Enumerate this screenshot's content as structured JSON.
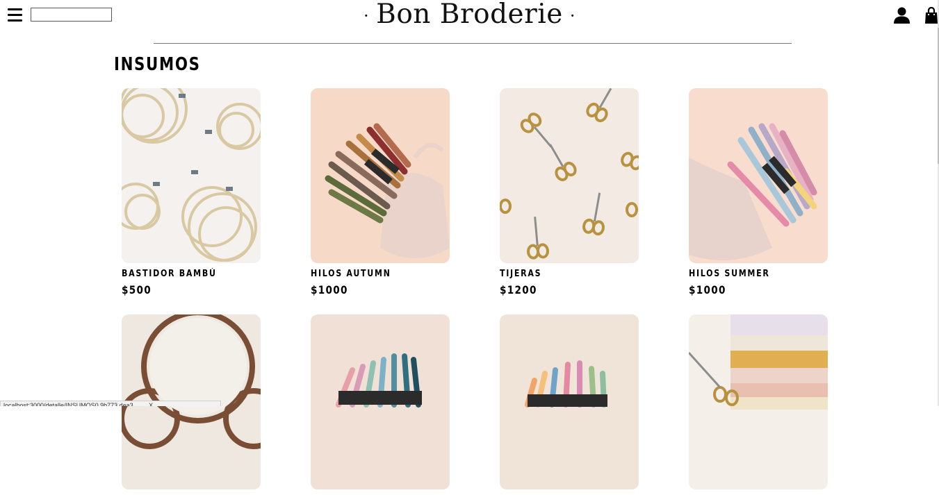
{
  "header": {
    "menu_icon": "hamburger-menu-icon",
    "search_value": "",
    "logo_text": "Bon Broderie",
    "logo_dot": "·",
    "user_icon": "user-icon",
    "bag_icon": "shopping-bag-icon"
  },
  "section": {
    "title": "INSUMOS"
  },
  "products": [
    {
      "name": "BASTIDOR BAMBÚ",
      "price": "$500"
    },
    {
      "name": "HILOS AUTUMN",
      "price": "$1000"
    },
    {
      "name": "TIJERAS",
      "price": "$1200"
    },
    {
      "name": "HILOS SUMMER",
      "price": "$1000"
    },
    {
      "name": "",
      "price": ""
    },
    {
      "name": "",
      "price": ""
    },
    {
      "name": "",
      "price": ""
    },
    {
      "name": "",
      "price": ""
    }
  ],
  "status_bar": {
    "text": "localhost:3000/detalle/INSUMOS0 9b773 dea3 ... ... X..."
  },
  "colors": {
    "background": "#ffffff",
    "text": "#000000",
    "rule": "#777777"
  }
}
